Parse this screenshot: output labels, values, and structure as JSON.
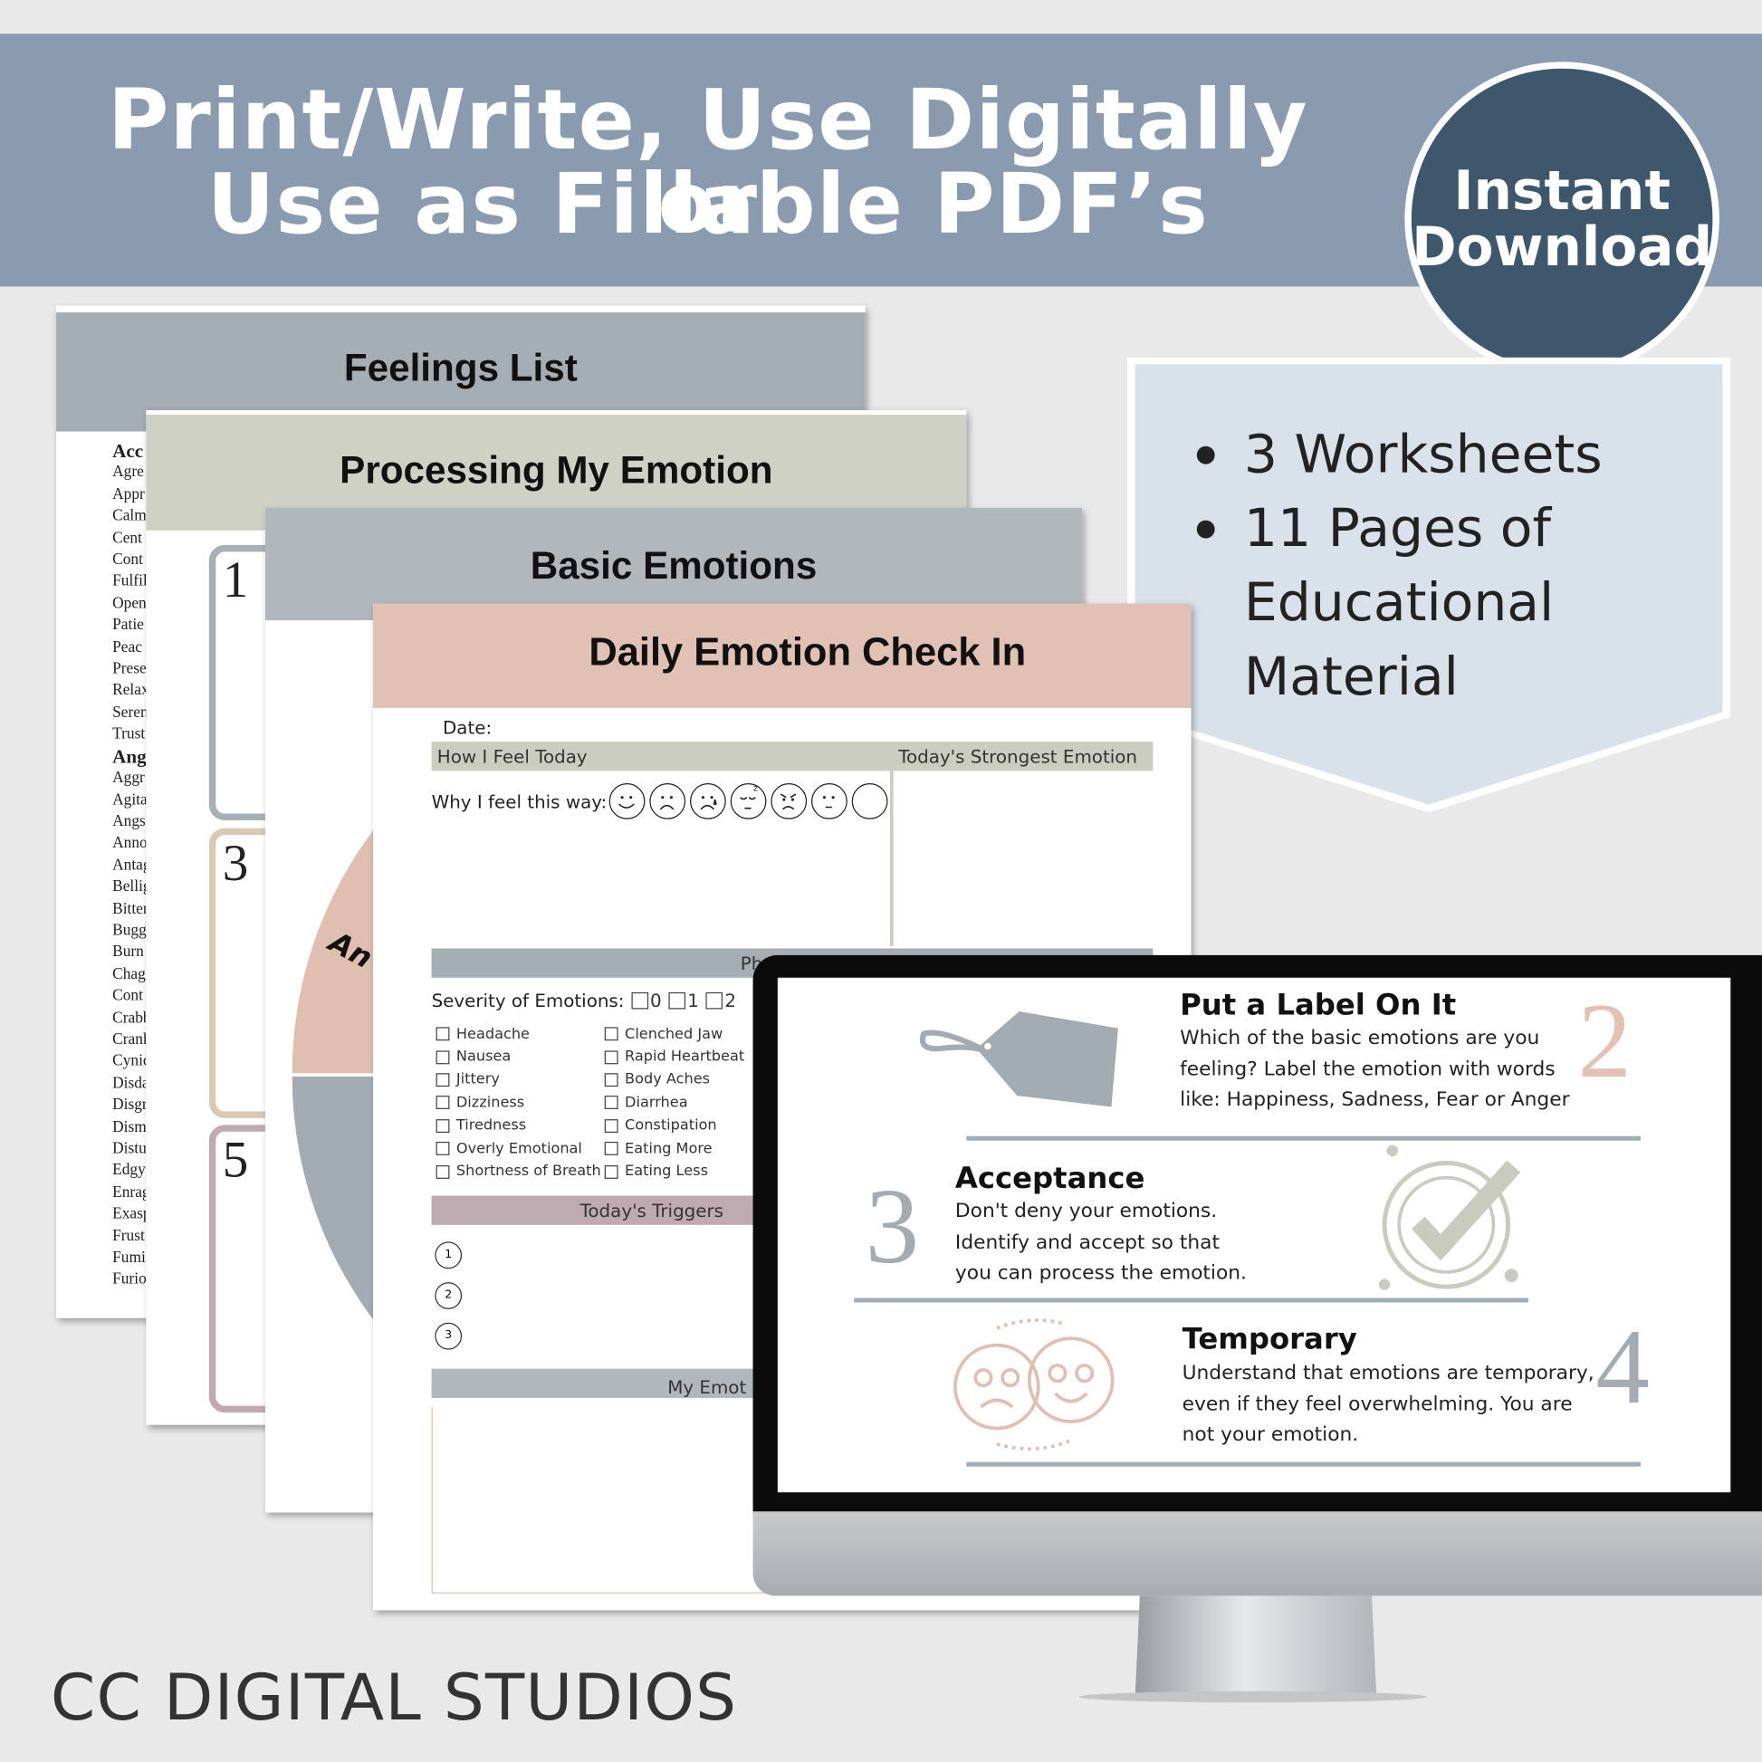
{
  "banner": {
    "title_line1": "Print/Write, Use Digitally or",
    "title_line2": "Use as Fillable PDF’s",
    "color": "#8a9bb0"
  },
  "badge": {
    "line1": "Instant",
    "line2": "Download",
    "color": "#3e576c"
  },
  "features": {
    "items": [
      "3 Worksheets",
      "11 Pages of",
      "Educational",
      "Material"
    ]
  },
  "pages": {
    "feelings_list": {
      "title": "Feelings List",
      "header_color": "#a6aeb5",
      "words": [
        "Acc",
        "Agre",
        "Appr",
        "Calm",
        "Cent",
        "Cont",
        "Fulfil",
        "Open",
        "Patie",
        "Peac",
        "Prese",
        "Relax",
        "Seren",
        "Trust",
        "Ang",
        "Aggr",
        "Agita",
        "Angs",
        "Anno",
        "Antag",
        "Bellig",
        "Bitter",
        "Bugg",
        "Burn",
        "Chag",
        "Cont",
        "Crabb",
        "Crank",
        "Cynic",
        "Disda",
        "Disgr",
        "Dism",
        "Distu",
        "Edgy",
        "Enrag",
        "Exasp",
        "Frust",
        "Fumi",
        "Furio"
      ]
    },
    "processing": {
      "title": "Processing My Emotion",
      "header_color": "#cfd1c5",
      "numbers": [
        "1",
        "3",
        "5"
      ]
    },
    "basic": {
      "title": "Basic Emotions",
      "header_color": "#b1b8bd",
      "wheel_label": "An"
    },
    "daily": {
      "title": "Daily Emotion Check In",
      "header_color": "#e0c1b3",
      "date_label": "Date:",
      "how_i_feel": "How I Feel Today",
      "strongest": "Today's Strongest Emotion",
      "why": "Why I feel this way:",
      "faces": [
        "happy",
        "sad",
        "crying",
        "sleepy",
        "angry",
        "neutral",
        "blank"
      ],
      "physical": "Physical Aff",
      "severity_label": "Severity of Emotions:",
      "severity_options": [
        "0",
        "1",
        "2"
      ],
      "symptoms_col1": [
        "Headache",
        "Nausea",
        "Jittery",
        "Dizziness",
        "Tiredness",
        "Overly Emotional",
        "Shortness of Breath"
      ],
      "symptoms_col2": [
        "Clenched Jaw",
        "Rapid Heartbeat",
        "Body Aches",
        "Diarrhea",
        "Constipation",
        "Eating More",
        "Eating Less"
      ],
      "triggers": "Today's Triggers",
      "trigger_numbers": [
        "1",
        "2",
        "3"
      ],
      "my_emotion": "My Emot"
    }
  },
  "monitor": {
    "steps": [
      {
        "number": "2",
        "title": "Put a Label On It",
        "lines": [
          "Which of the basic emotions are you",
          "feeling?  Label the emotion with words",
          "like: Happiness, Sadness, Fear or Anger"
        ],
        "icon": "tag-icon"
      },
      {
        "number": "3",
        "title": "Acceptance",
        "lines": [
          "Don't deny your emotions.",
          "Identify and accept so that",
          "you can process the emotion."
        ],
        "icon": "check-circle-icon"
      },
      {
        "number": "4",
        "title": "Temporary",
        "lines": [
          "Understand that emotions are temporary,",
          "even if they feel overwhelming.  You are",
          "not your emotion."
        ],
        "icon": "faces-cycle-icon"
      }
    ]
  },
  "brand": "CC DIGITAL STUDIOS"
}
